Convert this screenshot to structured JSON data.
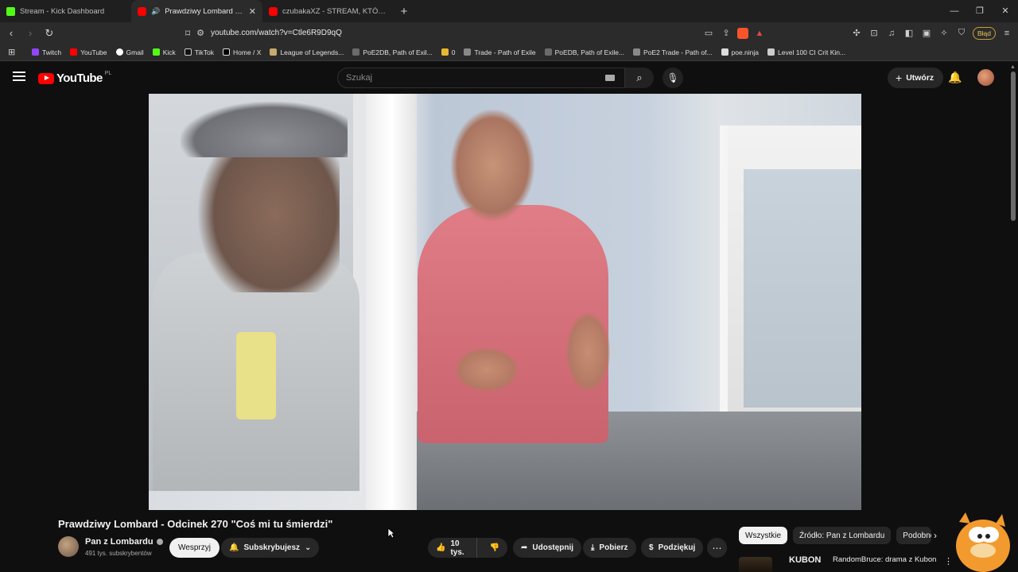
{
  "browser": {
    "tabs": [
      {
        "title": "Stream - Kick Dashboard",
        "favicon": "kick-icon",
        "active": false
      },
      {
        "title": "Prawdziwy Lombard - Odcinek",
        "favicon": "youtube-icon",
        "active": true
      },
      {
        "title": "czubakaXZ - STREAM, KTÓRY ROZWA",
        "favicon": "youtube-icon",
        "active": false
      }
    ],
    "url": "youtube.com/watch?v=Ctle6R9D9qQ",
    "error_badge": "Błąd",
    "bookmarks": [
      "Twitch",
      "YouTube",
      "Gmail",
      "Kick",
      "TikTok",
      "Home / X",
      "League of Legends...",
      "PoE2DB, Path of Exil...",
      "0",
      "Trade - Path of Exile",
      "PoEDB, Path of Exile...",
      "PoE2 Trade - Path of...",
      "poe.ninja",
      "Level 100 CI Crit Kin..."
    ]
  },
  "youtube": {
    "logo_text": "YouTube",
    "region": "PL",
    "search_placeholder": "Szukaj",
    "create_label": "Utwórz"
  },
  "video": {
    "title": "Prawdziwy Lombard - Odcinek 270 \"Coś mi tu śmierdzi\"",
    "channel_name": "Pan z Lombardu",
    "subscribers": "491 tys. subskrybentów",
    "support_label": "Wesprzyj",
    "subscribe_label": "Subskrybujesz",
    "likes": "10 tys.",
    "share_label": "Udostępnij",
    "download_label": "Pobierz",
    "thanks_label": "Podziękuj"
  },
  "sidebar": {
    "chips": [
      "Wszystkie",
      "Źródło: Pan z Lombardu",
      "Podobne"
    ],
    "active_chip": "Wszystkie",
    "recommendation": {
      "thumb_text": "KUBON",
      "title": "RandomBruce: drama z Kubonem, groźby zamieniają s"
    }
  }
}
